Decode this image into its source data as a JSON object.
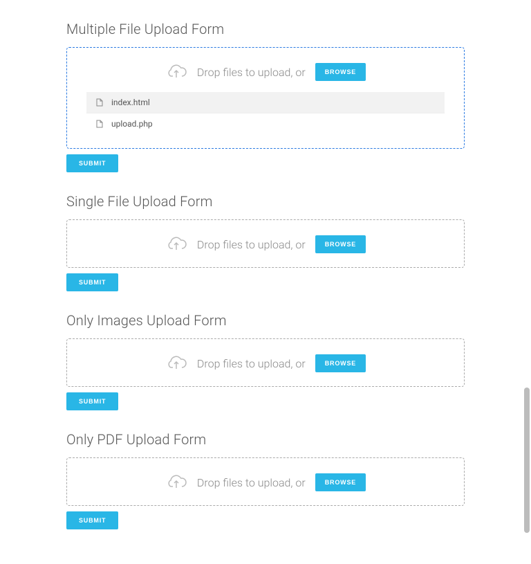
{
  "forms": [
    {
      "title": "Multiple File Upload Form",
      "dropText": "Drop files to upload, or",
      "browseLabel": "BROWSE",
      "submitLabel": "SUBMIT",
      "active": true,
      "files": [
        {
          "name": "index.html",
          "highlighted": true
        },
        {
          "name": "upload.php",
          "highlighted": false
        }
      ]
    },
    {
      "title": "Single File Upload Form",
      "dropText": "Drop files to upload, or",
      "browseLabel": "BROWSE",
      "submitLabel": "SUBMIT",
      "active": false,
      "files": []
    },
    {
      "title": "Only Images Upload Form",
      "dropText": "Drop files to upload, or",
      "browseLabel": "BROWSE",
      "submitLabel": "SUBMIT",
      "active": false,
      "files": []
    },
    {
      "title": "Only PDF Upload Form",
      "dropText": "Drop files to upload, or",
      "browseLabel": "BROWSE",
      "submitLabel": "SUBMIT",
      "active": false,
      "files": []
    }
  ]
}
